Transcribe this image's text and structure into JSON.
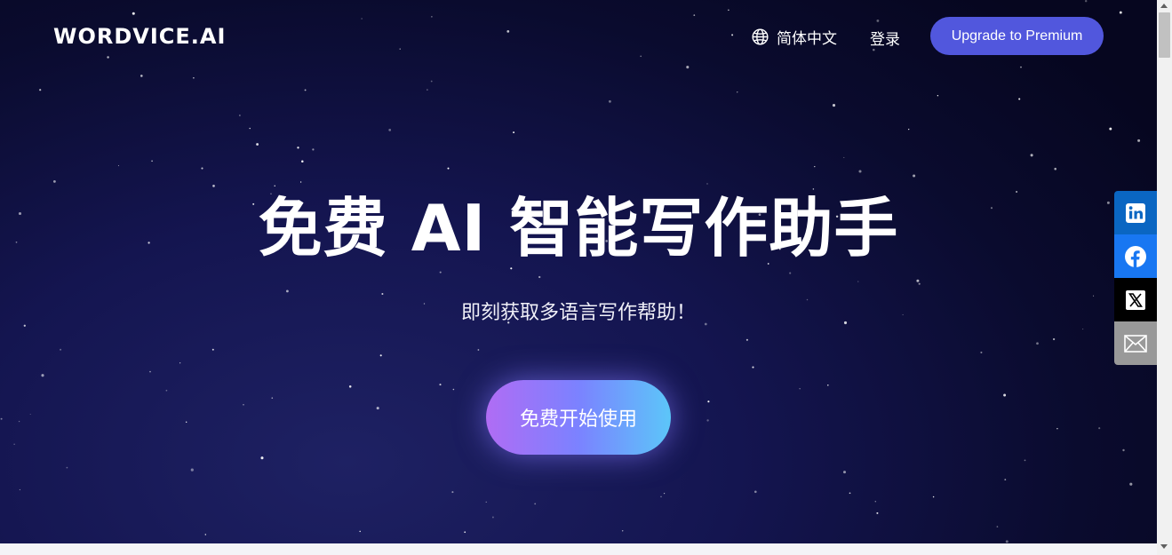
{
  "header": {
    "logo": "WORDVICE.AI",
    "language": "简体中文",
    "login": "登录",
    "upgrade_button": "Upgrade to Premium"
  },
  "hero": {
    "title": "免费 AI 智能写作助手",
    "subtitle": "即刻获取多语言写作帮助！",
    "cta": "免费开始使用"
  },
  "share": [
    "linkedin-icon",
    "facebook-icon",
    "x-icon",
    "email-icon"
  ],
  "colors": {
    "accent": "#5157dd",
    "cta_gradient": [
      "#b06cf4",
      "#7b82ff",
      "#5cc6f9"
    ],
    "linkedin": "#0a66c2",
    "facebook": "#1877f2",
    "x": "#000000",
    "email": "#999999"
  }
}
